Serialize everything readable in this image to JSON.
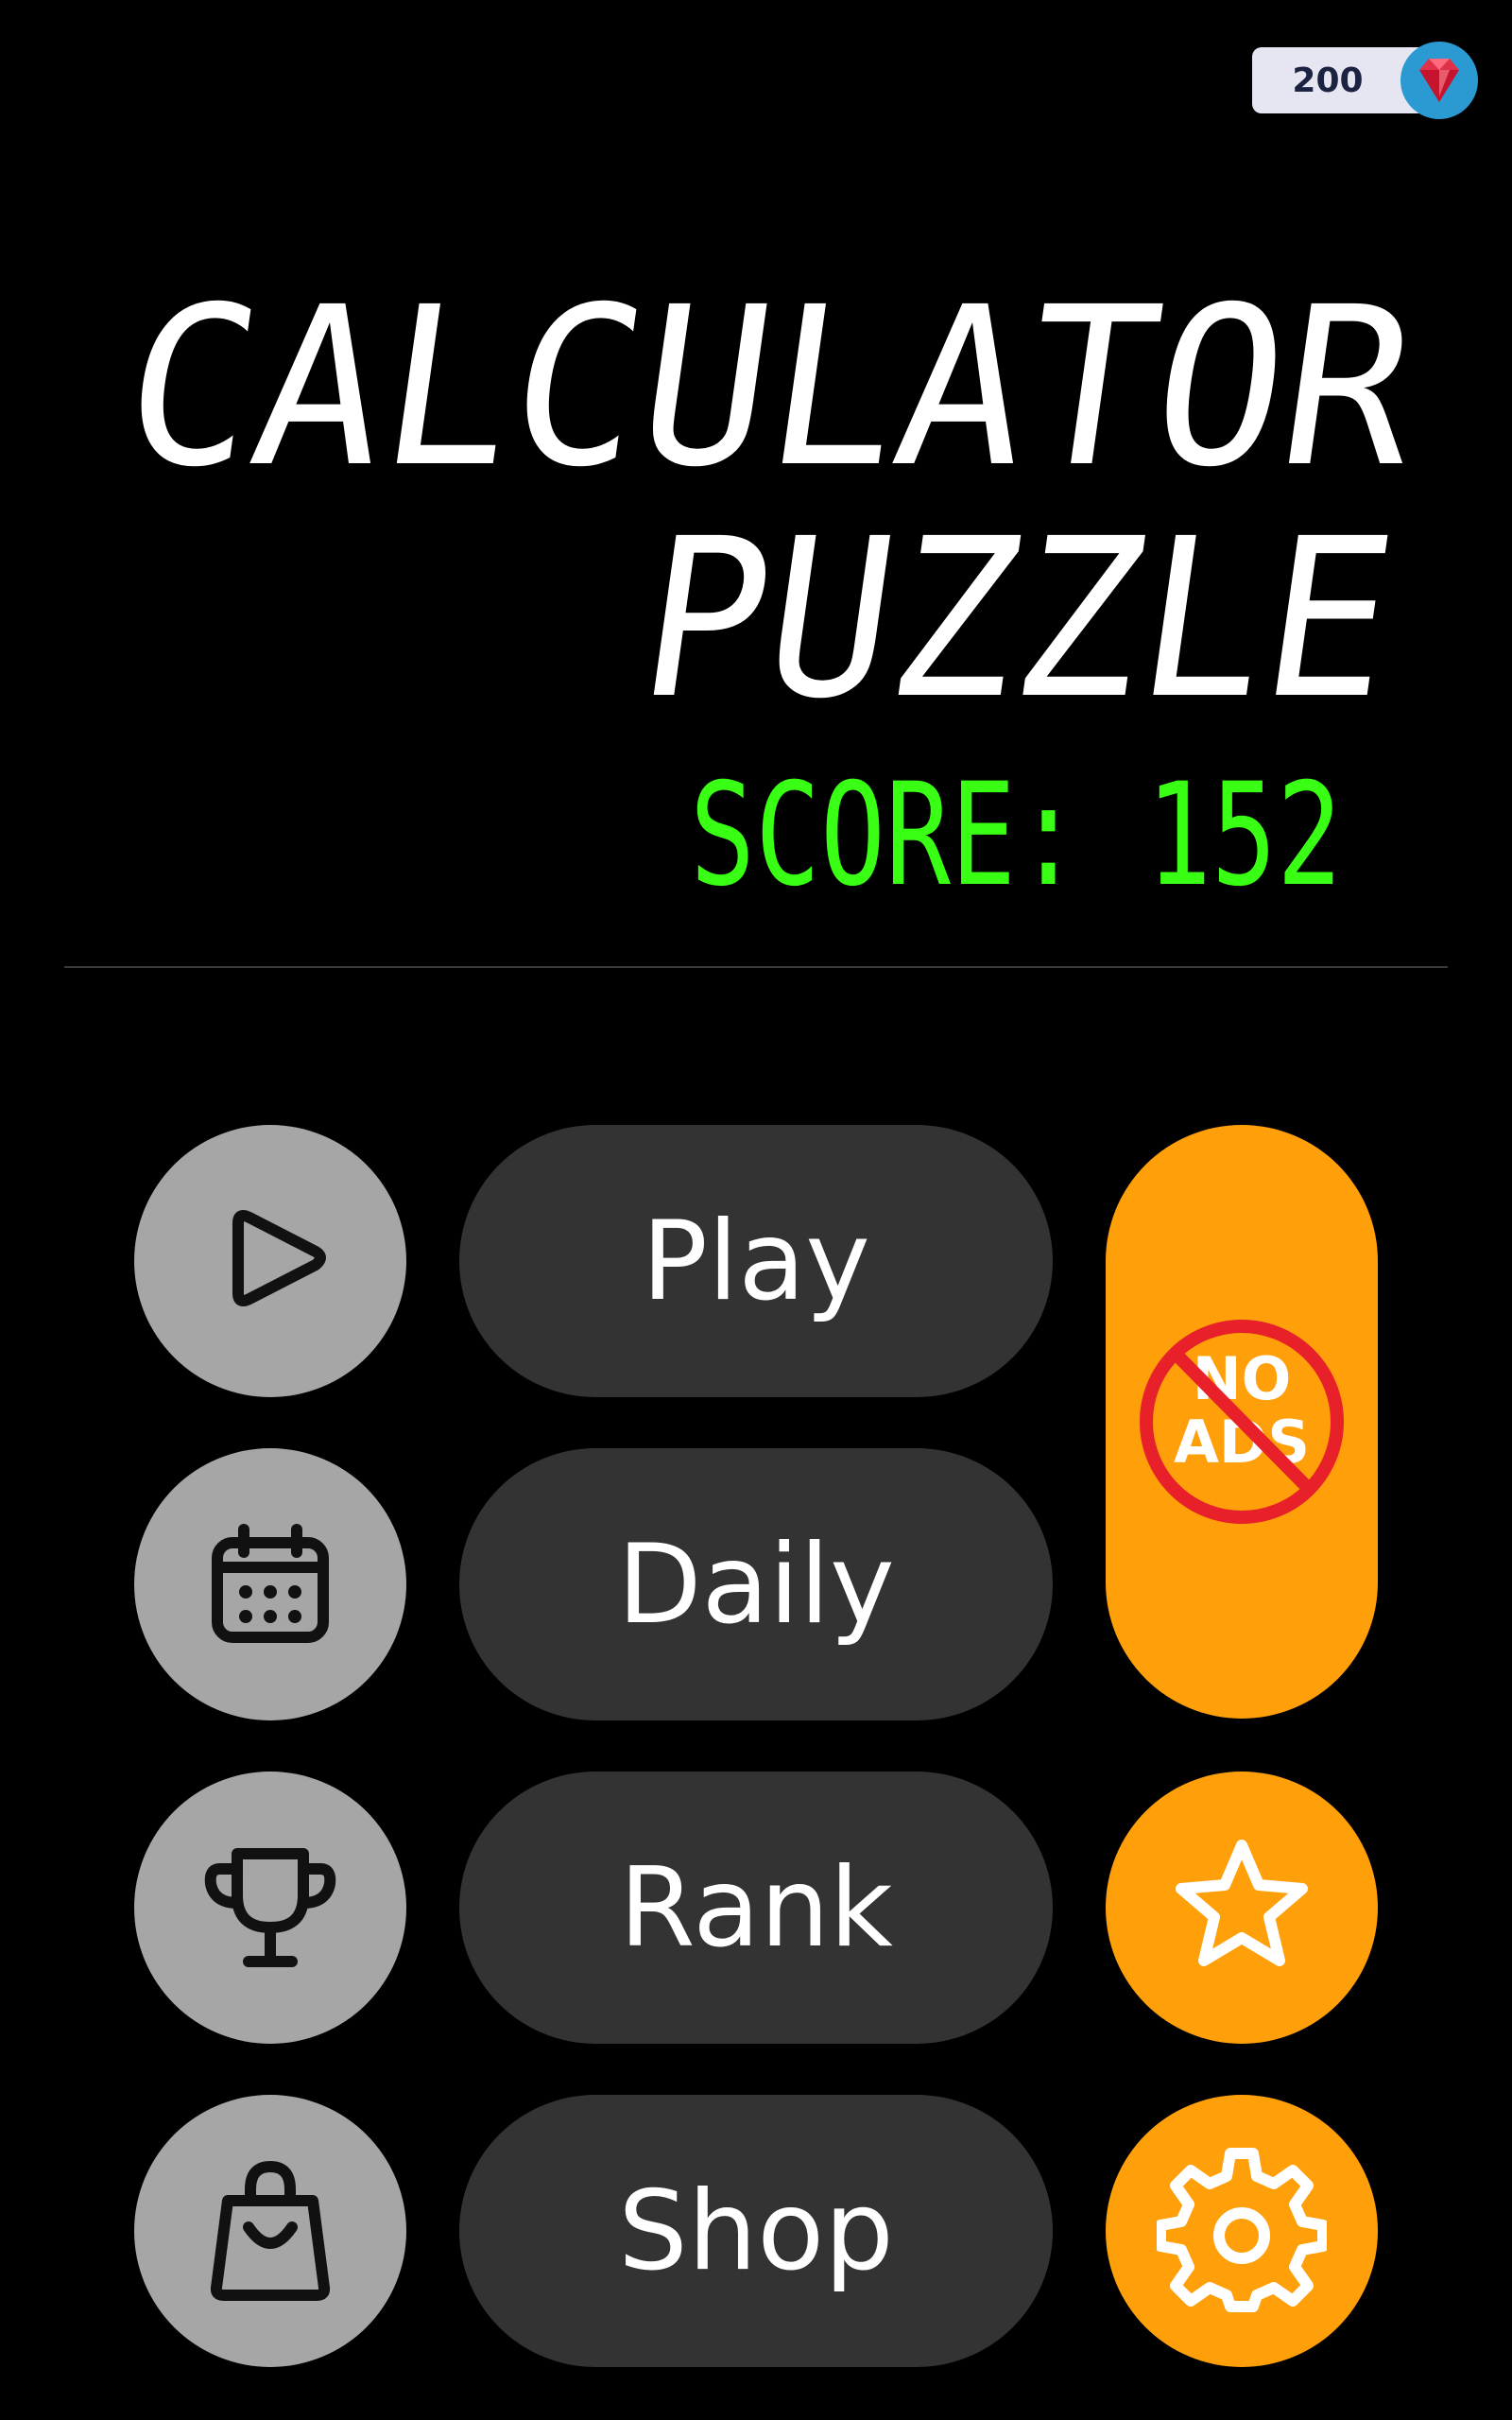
{
  "currency": {
    "amount": "200",
    "icon": "gem-icon"
  },
  "title": {
    "line1": "CALCULATOR",
    "line2": "PUZZLE",
    "score": "SCORE: 152"
  },
  "menu": {
    "play_label": "Play",
    "daily_label": "Daily",
    "rank_label": "Rank",
    "shop_label": "Shop"
  },
  "no_ads": {
    "label_line1": "NO",
    "label_line2": "ADS"
  },
  "colors": {
    "accent": "#ff9f0a",
    "score_green": "#39ff14",
    "button_gray": "#a6a6a6",
    "pill_dark": "#333333",
    "no_ads_red": "#e8202a"
  }
}
